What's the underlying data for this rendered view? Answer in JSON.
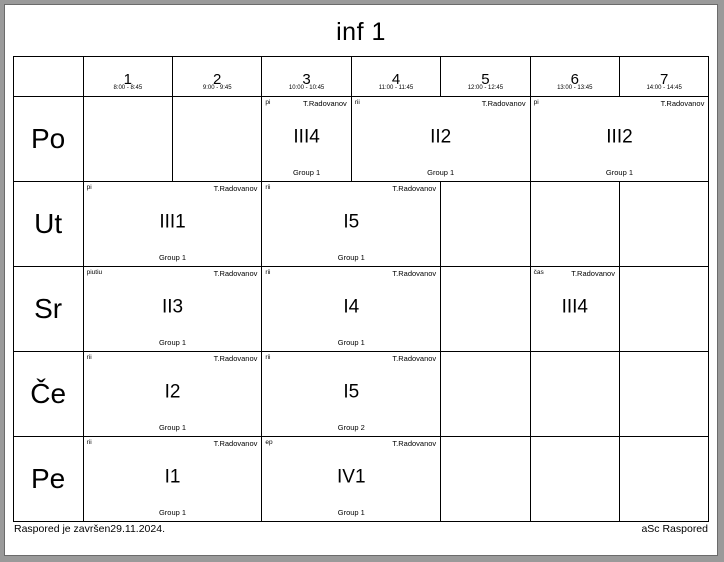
{
  "title": "inf 1",
  "periods": [
    {
      "num": "1",
      "time": "8:00 - 8:45"
    },
    {
      "num": "2",
      "time": "9:00 - 9:45"
    },
    {
      "num": "3",
      "time": "10:00 - 10:45"
    },
    {
      "num": "4",
      "time": "11:00 - 11:45"
    },
    {
      "num": "5",
      "time": "12:00 - 12:45"
    },
    {
      "num": "6",
      "time": "13:00 - 13:45"
    },
    {
      "num": "7",
      "time": "14:00 - 14:45"
    }
  ],
  "days": [
    {
      "label": "Po"
    },
    {
      "label": "Ut"
    },
    {
      "label": "Sr"
    },
    {
      "label": "Če"
    },
    {
      "label": "Pe"
    }
  ],
  "lessons": {
    "po_3": {
      "subject": "pi",
      "teacher": "T.Radovanov",
      "class": "III4",
      "group": "Group 1"
    },
    "po_45": {
      "subject": "rii",
      "teacher": "T.Radovanov",
      "class": "II2",
      "group": "Group 1"
    },
    "po_67": {
      "subject": "pi",
      "teacher": "T.Radovanov",
      "class": "III2",
      "group": "Group 1"
    },
    "ut_12": {
      "subject": "pi",
      "teacher": "T.Radovanov",
      "class": "III1",
      "group": "Group 1"
    },
    "ut_34": {
      "subject": "rii",
      "teacher": "T.Radovanov",
      "class": "I5",
      "group": "Group 1"
    },
    "sr_12": {
      "subject": "piutiu",
      "teacher": "T.Radovanov",
      "class": "II3",
      "group": "Group 1"
    },
    "sr_34": {
      "subject": "rii",
      "teacher": "T.Radovanov",
      "class": "I4",
      "group": "Group 1"
    },
    "sr_6": {
      "subject": "čas",
      "teacher": "T.Radovanov",
      "class": "III4",
      "group": ""
    },
    "ce_12": {
      "subject": "rii",
      "teacher": "T.Radovanov",
      "class": "I2",
      "group": "Group 1"
    },
    "ce_34": {
      "subject": "rii",
      "teacher": "T.Radovanov",
      "class": "I5",
      "group": "Group 2"
    },
    "pe_12": {
      "subject": "rii",
      "teacher": "T.Radovanov",
      "class": "I1",
      "group": "Group 1"
    },
    "pe_34": {
      "subject": "ep",
      "teacher": "T.Radovanov",
      "class": "IV1",
      "group": "Group 1"
    }
  },
  "footer": {
    "left": "Raspored je završen29.11.2024.",
    "right": "aSc Raspored"
  }
}
